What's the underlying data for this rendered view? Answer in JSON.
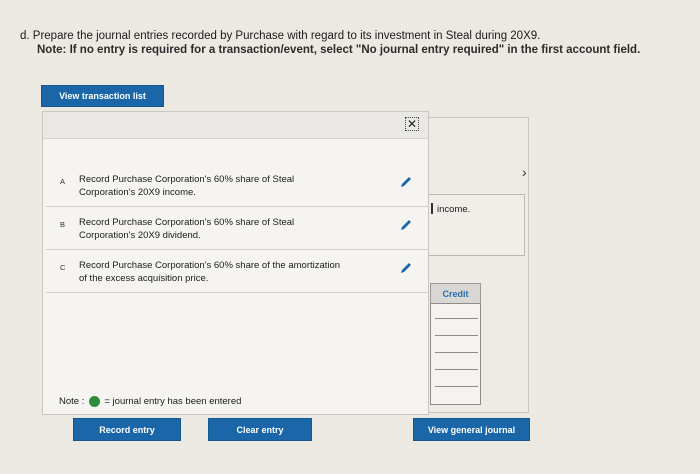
{
  "header": {
    "question": "d. Prepare the journal entries recorded by Purchase with regard to its investment in Steal during 20X9.",
    "note": "Note: If no entry is required for a transaction/event, select \"No journal entry required\" in the first account field."
  },
  "buttons": {
    "view_transaction_list": "View transaction list",
    "record_entry": "Record entry",
    "clear_entry": "Clear entry",
    "view_general_journal": "View general journal"
  },
  "transactions": [
    {
      "letter": "A",
      "text": "Record Purchase Corporation's 60% share of Steal Corporation's 20X9 income."
    },
    {
      "letter": "B",
      "text": "Record Purchase Corporation's 60% share of Steal Corporation's 20X9 dividend."
    },
    {
      "letter": "C",
      "text": "Record Purchase Corporation's 60% share of the amortization of the excess acquisition price."
    }
  ],
  "note_legend": {
    "prefix": "Note :",
    "suffix": "= journal entry has been entered"
  },
  "background_panel": {
    "partial_text": "income.",
    "credit_header": "Credit",
    "chevron": "›"
  },
  "icons": {
    "close": "✕",
    "edit": "pencil-icon"
  },
  "colors": {
    "button_blue": "#1a66a8",
    "entered_green": "#2f8b3e",
    "credit_header_text": "#2b6fb0"
  }
}
